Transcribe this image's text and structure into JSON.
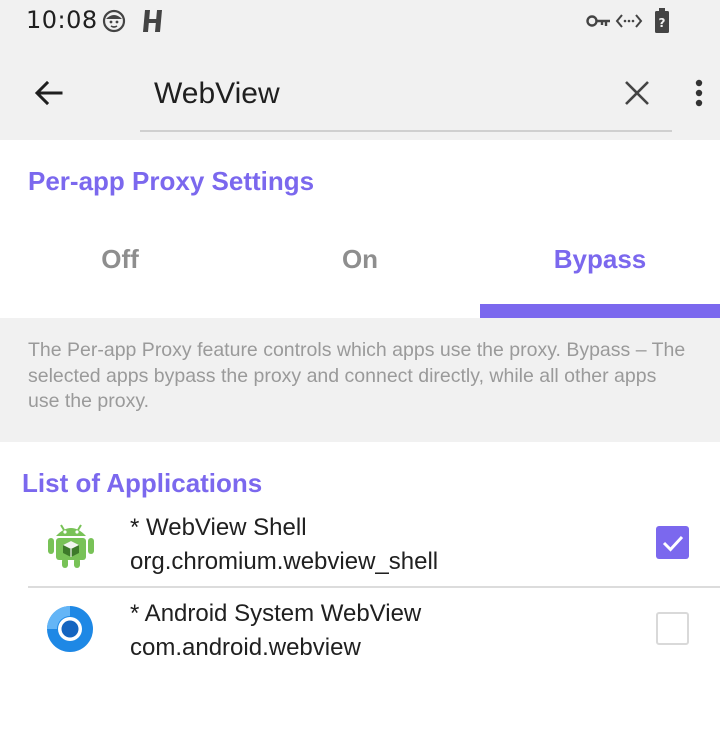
{
  "status_bar": {
    "time": "10:08",
    "icons": [
      "face-icon",
      "h-logo-icon",
      "vpn-key-icon",
      "code-arrows-icon",
      "battery-unknown-icon"
    ]
  },
  "toolbar": {
    "search_value": "WebView",
    "back_icon": "arrow-back-icon",
    "clear_icon": "close-icon",
    "more_icon": "more-vert-icon"
  },
  "proxy_settings": {
    "title": "Per-app Proxy Settings",
    "tabs": [
      {
        "label": "Off",
        "selected": false
      },
      {
        "label": "On",
        "selected": false
      },
      {
        "label": "Bypass",
        "selected": true
      }
    ],
    "description": "The Per-app Proxy feature controls which apps use the proxy. Bypass – The selected apps bypass the proxy and connect directly, while all other apps use the proxy."
  },
  "applications": {
    "title": "List of Applications",
    "items": [
      {
        "name": "* WebView Shell",
        "package": "org.chromium.webview_shell",
        "icon": "android-robot-icon",
        "checked": true
      },
      {
        "name": "* Android System WebView",
        "package": "com.android.webview",
        "icon": "chromium-webview-icon",
        "checked": false
      }
    ]
  },
  "colors": {
    "accent": "#7b68ee",
    "bar_background": "#f1f1f1",
    "muted_text": "#9a9a9a"
  }
}
